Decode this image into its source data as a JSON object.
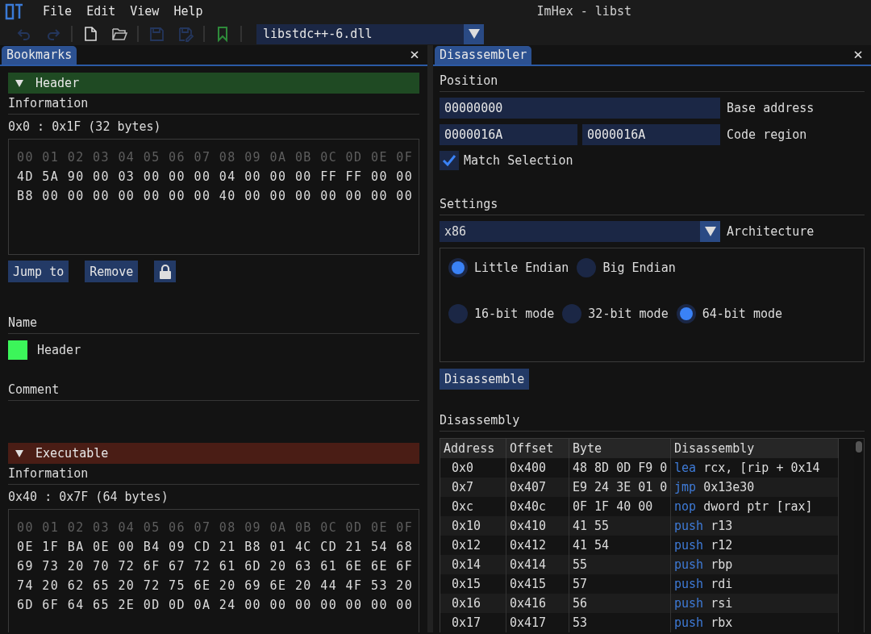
{
  "menu": {
    "items": [
      "File",
      "Edit",
      "View",
      "Help"
    ],
    "title": "ImHex - libst"
  },
  "toolbar": {
    "file": "libstdc++-6.dll"
  },
  "bookmarks_panel": {
    "tab": "Bookmarks",
    "close": "×",
    "bookmarks": [
      {
        "title": "Header",
        "color": "#1f4a23",
        "expanded": true,
        "info_label": "Information",
        "range": "0x0 : 0x1F (32 bytes)",
        "hex_header": "00 01 02 03 04 05 06 07 08 09 0A 0B 0C 0D 0E 0F",
        "hex_rows": [
          "4D 5A 90 00 03 00 00 00 04 00 00 00 FF FF 00 00",
          "B8 00 00 00 00 00 00 00 40 00 00 00 00 00 00 00"
        ],
        "buttons": [
          "Jump to",
          "Remove"
        ],
        "locked": true,
        "name_label": "Name",
        "swatch": {
          "color": "#3cf55a"
        },
        "name": "Header",
        "comment_label": "Comment"
      },
      {
        "title": "Executable",
        "color": "#4a1d15",
        "expanded": true,
        "info_label": "Information",
        "range": "0x40 : 0x7F (64 bytes)",
        "hex_header": "00 01 02 03 04 05 06 07 08 09 0A 0B 0C 0D 0E 0F",
        "hex_rows": [
          "0E 1F BA 0E 00 B4 09 CD 21 B8 01 4C CD 21 54 68",
          "69 73 20 70 72 6F 67 72 61 6D 20 63 61 6E 6E 6F",
          "74 20 62 65 20 72 75 6E 20 69 6E 20 44 4F 53 20",
          "6D 6F 64 65 2E 0D 0D 0A 24 00 00 00 00 00 00 00"
        ]
      }
    ]
  },
  "disassembler_panel": {
    "tab": "Disassembler",
    "close": "×",
    "position_label": "Position",
    "base_address": "00000000",
    "base_address_label": "Base address",
    "region_start": "0000016A",
    "region_end": "0000016A",
    "region_label": "Code region",
    "match_selection": {
      "label": "Match Selection",
      "checked": true
    },
    "settings_label": "Settings",
    "architecture": "x86",
    "architecture_label": "Architecture",
    "radio_rows": [
      {
        "options": [
          {
            "label": "Little Endian",
            "selected": true
          },
          {
            "label": "Big Endian",
            "selected": false
          }
        ]
      },
      {
        "options": [
          {
            "label": "16-bit mode",
            "selected": false
          },
          {
            "label": "32-bit mode",
            "selected": false
          },
          {
            "label": "64-bit mode",
            "selected": true
          }
        ]
      }
    ],
    "disassemble_button": "Disassemble",
    "disassembly_label": "Disassembly",
    "table": {
      "columns": [
        "Address",
        "Offset",
        "Byte",
        "Disassembly"
      ],
      "rows": [
        {
          "address": "0x0",
          "offset": "0x400",
          "bytes": "48 8D 0D F9 0",
          "mnemonic": "lea",
          "operands": "rcx, [rip + 0x14"
        },
        {
          "address": "0x7",
          "offset": "0x407",
          "bytes": "E9 24 3E 01 0",
          "mnemonic": "jmp",
          "operands": "0x13e30"
        },
        {
          "address": "0xc",
          "offset": "0x40c",
          "bytes": "0F 1F 40 00",
          "mnemonic": "nop",
          "operands": "dword ptr [rax]"
        },
        {
          "address": "0x10",
          "offset": "0x410",
          "bytes": "41 55",
          "mnemonic": "push",
          "operands": "r13"
        },
        {
          "address": "0x12",
          "offset": "0x412",
          "bytes": "41 54",
          "mnemonic": "push",
          "operands": "r12"
        },
        {
          "address": "0x14",
          "offset": "0x414",
          "bytes": "55",
          "mnemonic": "push",
          "operands": "rbp"
        },
        {
          "address": "0x15",
          "offset": "0x415",
          "bytes": "57",
          "mnemonic": "push",
          "operands": "rdi"
        },
        {
          "address": "0x16",
          "offset": "0x416",
          "bytes": "56",
          "mnemonic": "push",
          "operands": "rsi"
        },
        {
          "address": "0x17",
          "offset": "0x417",
          "bytes": "53",
          "mnemonic": "push",
          "operands": "rbx"
        }
      ]
    }
  }
}
